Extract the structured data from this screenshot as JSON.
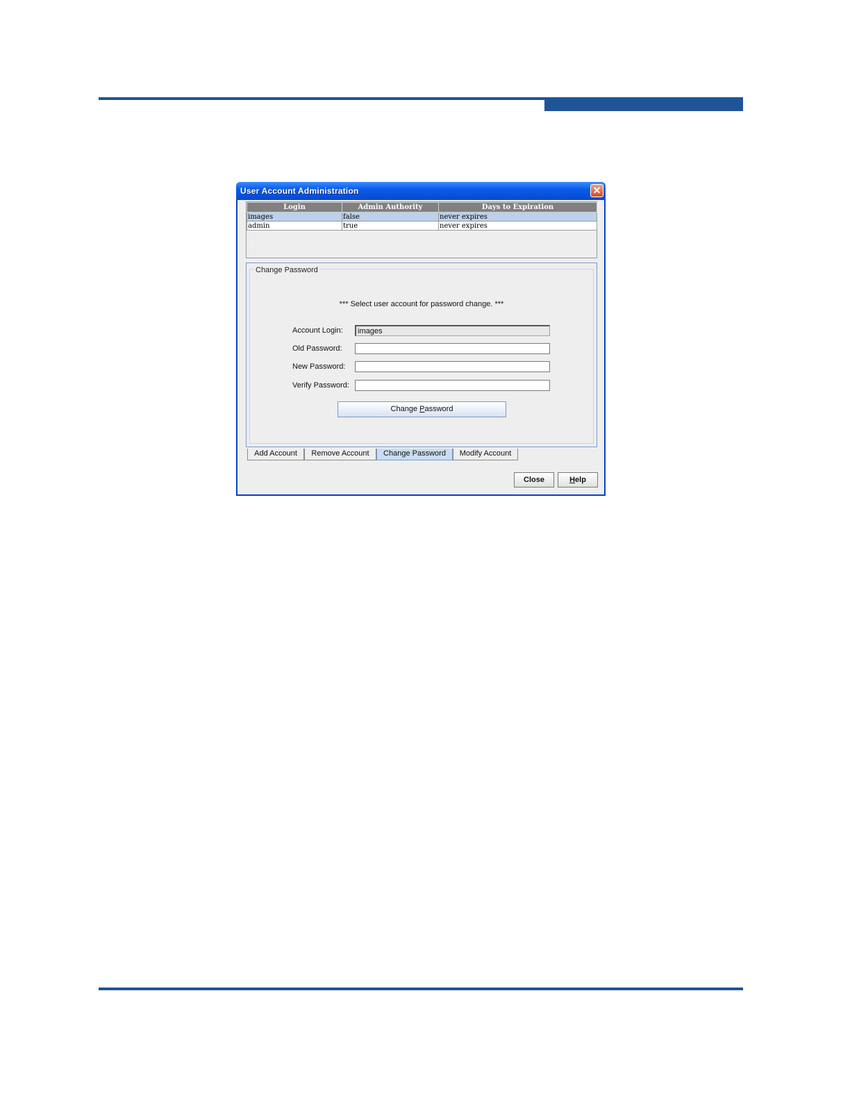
{
  "window": {
    "title": "User Account Administration",
    "close_glyph": "✕"
  },
  "table": {
    "columns": [
      "Login",
      "Admin Authority",
      "Days to Expiration"
    ],
    "rows": [
      {
        "login": "images",
        "admin": "false",
        "days": "never expires"
      },
      {
        "login": "admin",
        "admin": "true",
        "days": "never expires"
      }
    ]
  },
  "panel": {
    "title": "Change Password",
    "hint": "*** Select user account for password change. ***",
    "fields": {
      "account_login_label": "Account Login:",
      "account_login_value": "images",
      "old_password_label": "Old Password:",
      "new_password_label": "New Password:",
      "verify_password_label": "Verify Password:"
    },
    "change_button_pre": "Change ",
    "change_button_mnemonic": "P",
    "change_button_post": "assword"
  },
  "tabs": [
    {
      "label": "Add Account"
    },
    {
      "label": "Remove Account"
    },
    {
      "label": "Change Password"
    },
    {
      "label": "Modify Account"
    }
  ],
  "buttons": {
    "close": "Close",
    "help_mnemonic": "H",
    "help_rest": "elp"
  },
  "colors": {
    "accent": "#1f5597",
    "titlebar": "#0a5ce8",
    "selected_row": "#bcd1ea"
  }
}
